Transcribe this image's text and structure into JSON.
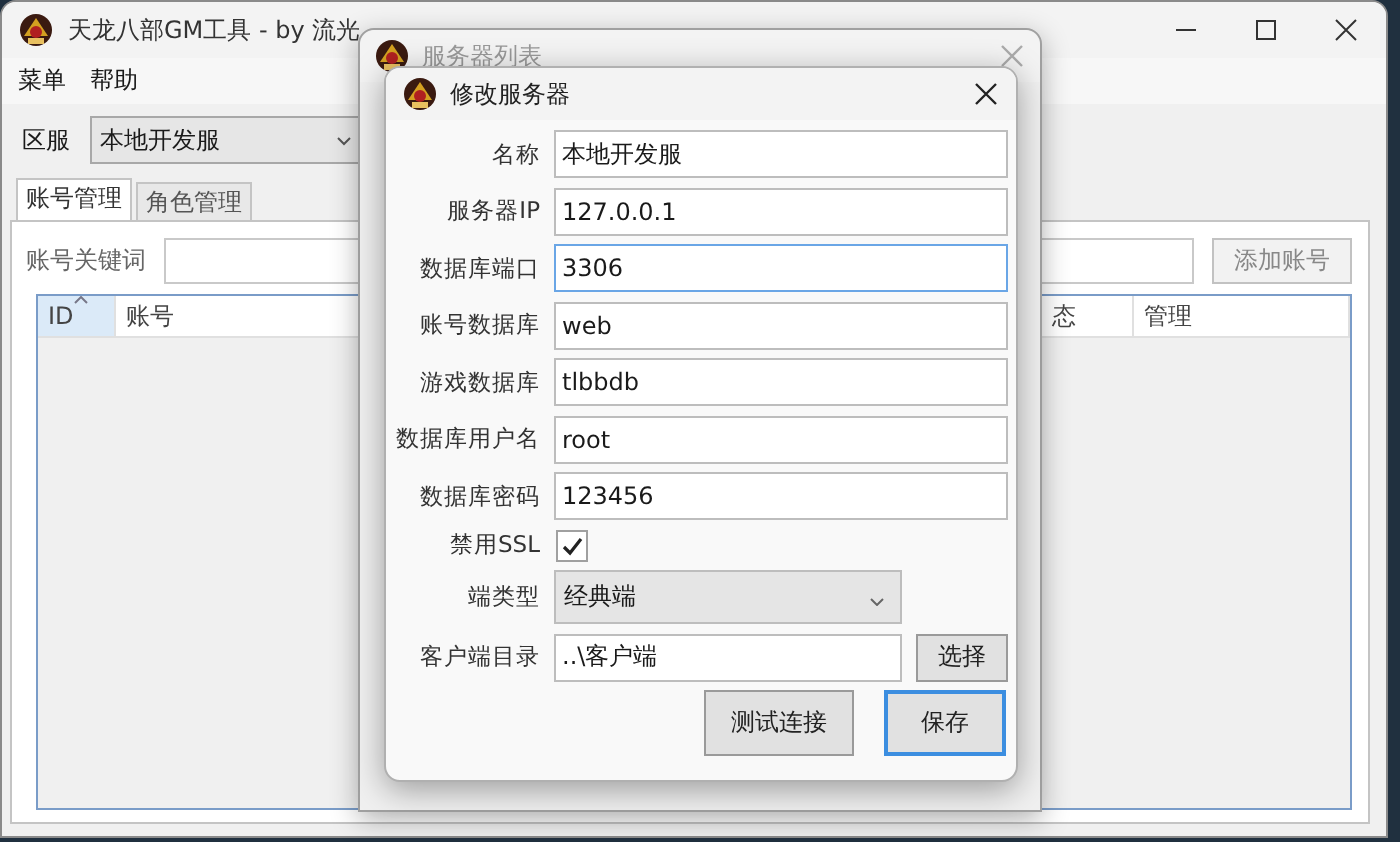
{
  "main_window": {
    "title": "天龙八部GM工具 - by 流光",
    "menu": [
      "菜单",
      "帮助"
    ],
    "server_label": "区服",
    "server_select": {
      "value": "本地开发服"
    },
    "tabs": [
      {
        "label": "账号管理",
        "selected": true
      },
      {
        "label": "角色管理",
        "selected": false
      }
    ],
    "keyword_label": "账号关键词",
    "add_button": "添加账号",
    "table": {
      "columns": [
        "ID",
        "账号",
        "态",
        "管理"
      ]
    }
  },
  "list_dialog": {
    "title": "服务器列表",
    "active": false
  },
  "edit_dialog": {
    "title": "修改服务器",
    "active": true,
    "fields": [
      {
        "label": "名称",
        "value": "本地开发服",
        "focused": false
      },
      {
        "label": "服务器IP",
        "value": "127.0.0.1",
        "focused": false
      },
      {
        "label": "数据库端口",
        "value": "3306",
        "focused": true
      },
      {
        "label": "账号数据库",
        "value": "web",
        "focused": false
      },
      {
        "label": "游戏数据库",
        "value": "tlbbdb",
        "focused": false
      },
      {
        "label": "数据库用户名",
        "value": "root",
        "focused": false
      },
      {
        "label": "数据库密码",
        "value": "123456",
        "focused": false
      }
    ],
    "ssl": {
      "label": "禁用SSL",
      "checked": true
    },
    "client_type": {
      "label": "端类型",
      "value": "经典端"
    },
    "client_dir": {
      "label": "客户端目录",
      "value": "..\\客户端",
      "button": "选择"
    },
    "buttons": [
      {
        "label": "测试连接",
        "default": false
      },
      {
        "label": "保存",
        "default": true
      }
    ]
  }
}
